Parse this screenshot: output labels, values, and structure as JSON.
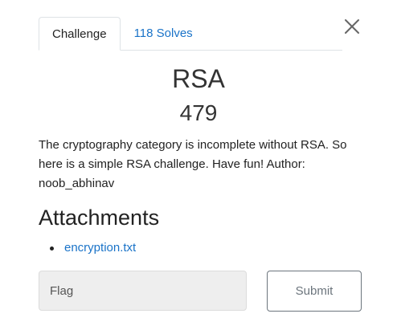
{
  "tabs": [
    {
      "label": "Challenge",
      "active": true
    },
    {
      "label": "118 Solves",
      "active": false
    }
  ],
  "icons": {
    "close": "close-icon",
    "bullet": "bullet-icon"
  },
  "challenge": {
    "name": "RSA",
    "points": "479",
    "description": "The cryptography category is incomplete without RSA. So here is a simple RSA challenge. Have fun! Author: noob_abhinav"
  },
  "attachments": {
    "heading": "Attachments",
    "files": [
      "encryption.txt"
    ]
  },
  "form": {
    "flag_placeholder": "Flag",
    "flag_value": "",
    "submit_label": "Submit"
  },
  "colors": {
    "link": "#1a73c8",
    "input_bg": "#eeeeee",
    "button_border": "#6c757d"
  }
}
